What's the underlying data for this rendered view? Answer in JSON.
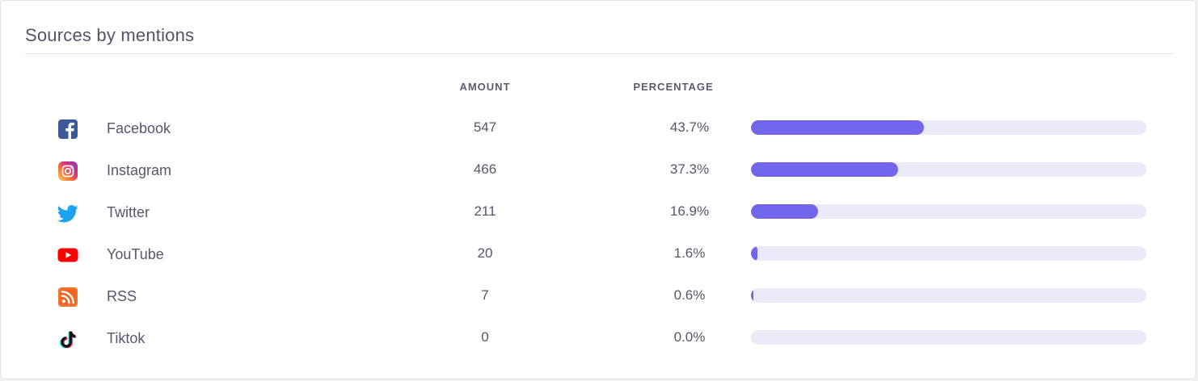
{
  "card": {
    "title": "Sources by mentions"
  },
  "table": {
    "headers": {
      "amount": "AMOUNT",
      "percentage": "PERCENTAGE"
    },
    "rows": [
      {
        "icon": "facebook-icon",
        "name": "Facebook",
        "amount": "547",
        "percentage": "43.7%",
        "fraction": 0.437
      },
      {
        "icon": "instagram-icon",
        "name": "Instagram",
        "amount": "466",
        "percentage": "37.3%",
        "fraction": 0.373
      },
      {
        "icon": "twitter-icon",
        "name": "Twitter",
        "amount": "211",
        "percentage": "16.9%",
        "fraction": 0.169
      },
      {
        "icon": "youtube-icon",
        "name": "YouTube",
        "amount": "20",
        "percentage": "1.6%",
        "fraction": 0.016
      },
      {
        "icon": "rss-icon",
        "name": "RSS",
        "amount": "7",
        "percentage": "0.6%",
        "fraction": 0.006
      },
      {
        "icon": "tiktok-icon",
        "name": "Tiktok",
        "amount": "0",
        "percentage": "0.0%",
        "fraction": 0.0
      }
    ]
  },
  "colors": {
    "bar_fill": "#7466ec",
    "bar_track": "#ebeaf9",
    "facebook": "#3b5998",
    "twitter": "#1da1f2",
    "youtube": "#ff0000",
    "rss": "#f26522"
  }
}
